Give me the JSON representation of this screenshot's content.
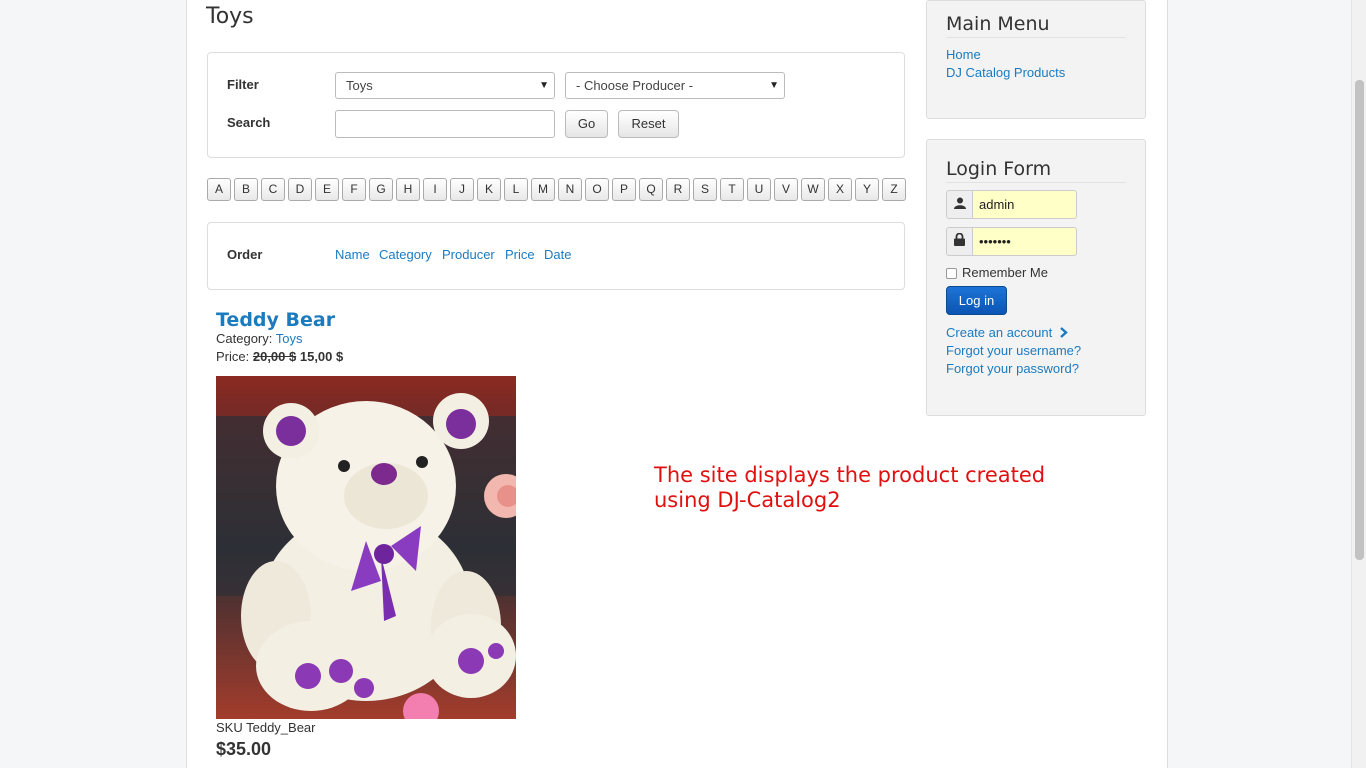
{
  "page_title": "Toys",
  "filter": {
    "filter_label": "Filter",
    "search_label": "Search",
    "category_select": "Toys",
    "producer_select": "- Choose Producer -",
    "search_value": "",
    "go_label": "Go",
    "reset_label": "Reset"
  },
  "letters": [
    "A",
    "B",
    "C",
    "D",
    "E",
    "F",
    "G",
    "H",
    "I",
    "J",
    "K",
    "L",
    "M",
    "N",
    "O",
    "P",
    "Q",
    "R",
    "S",
    "T",
    "U",
    "V",
    "W",
    "X",
    "Y",
    "Z"
  ],
  "order": {
    "label": "Order",
    "options": [
      "Name",
      "Category",
      "Producer",
      "Price",
      "Date"
    ]
  },
  "product": {
    "name": "Teddy Bear",
    "category_label": "Category:",
    "category": "Toys",
    "price_label": "Price:",
    "old_price": "20,00 $",
    "new_price": "15,00 $",
    "sku": "SKU Teddy_Bear",
    "big_price": "$35.00"
  },
  "annotation": "The site displays the product created using DJ-Catalog2",
  "main_menu": {
    "title": "Main Menu",
    "items": [
      "Home",
      "DJ Catalog Products"
    ]
  },
  "login_form": {
    "title": "Login Form",
    "username": "admin",
    "password": "•••••••",
    "remember_label": "Remember Me",
    "login_label": "Log in",
    "create_account": "Create an account",
    "forgot_username": "Forgot your username?",
    "forgot_password": "Forgot your password?"
  },
  "icons": {
    "user": "user-icon",
    "lock": "lock-icon",
    "chevron": "chevron-right-icon"
  }
}
